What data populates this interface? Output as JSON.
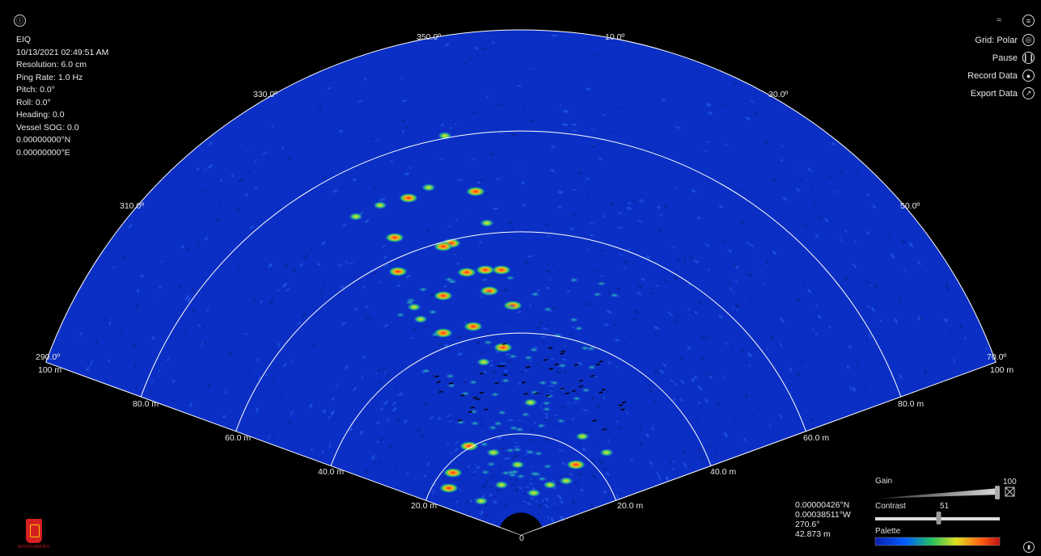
{
  "app": {
    "logo_text": "KONGSBERG"
  },
  "info": {
    "device": "EIQ",
    "timestamp": "10/13/2021 02:49:51 AM",
    "resolution": "Resolution: 6.0 cm",
    "ping_rate": "Ping Rate: 1.0 Hz",
    "pitch": "Pitch:   0.0°",
    "roll": "Roll:   0.0°",
    "heading": "Heading: 0.0",
    "vessel_sog": "Vessel SOG: 0.0",
    "lat": "0.00000000°N",
    "lon": "0.00000000°E"
  },
  "controls": {
    "grid_label": "Grid: Polar",
    "pause_label": "Pause",
    "record_label": "Record Data",
    "export_label": "Export Data"
  },
  "bearings": {
    "b350": "350.0º",
    "b10": "10.0º",
    "b330": "330.0º",
    "b30": "30.0º",
    "b310": "310.0º",
    "b50": "50.0º",
    "b290": "290.0º",
    "b70": "70.0º"
  },
  "ranges": {
    "r100": "100 m",
    "r80": "80.0 m",
    "r60": "60.0 m",
    "r40": "40.0 m",
    "r20": "20.0 m",
    "origin": "0"
  },
  "cursor": {
    "lat": "0.00000426°N",
    "lon": "0.00038511°W",
    "bearing": "270.6°",
    "range": "42.873 m"
  },
  "panel": {
    "gain_label": "Gain",
    "gain_value": "100",
    "gain_level": 1.0,
    "contrast_label": "Contrast",
    "contrast_value": "51",
    "contrast_level": 0.51,
    "palette_label": "Palette"
  },
  "colors": {
    "background": "#000000",
    "sonar_base": "#0b2fc4",
    "grid_line": "#ffffff"
  }
}
